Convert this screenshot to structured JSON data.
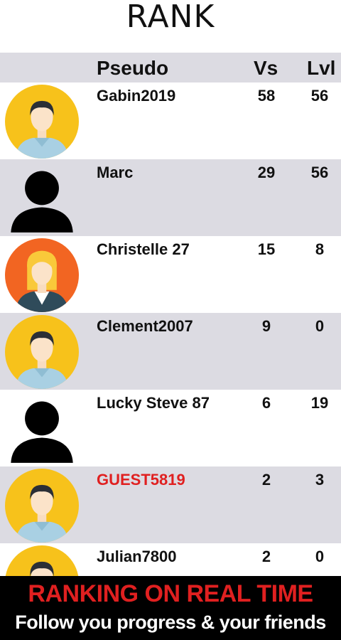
{
  "title": "RANK",
  "columns": {
    "pseudo": "Pseudo",
    "vs": "Vs",
    "lvl": "Lvl"
  },
  "colors": {
    "highlight": "#e02020",
    "row_alt": "#dcdbe2",
    "banner_bg": "#000000"
  },
  "rows": [
    {
      "name": "Gabin2019",
      "vs": "58",
      "lvl": "56",
      "avatar": "man-avatar-icon"
    },
    {
      "name": "Marc",
      "vs": "29",
      "lvl": "56",
      "avatar": "silhouette-avatar-icon"
    },
    {
      "name": "Christelle 27",
      "vs": "15",
      "lvl": "8",
      "avatar": "woman-avatar-icon"
    },
    {
      "name": "Clement2007",
      "vs": "9",
      "lvl": "0",
      "avatar": "man-avatar-icon"
    },
    {
      "name": "Lucky Steve 87",
      "vs": "6",
      "lvl": "19",
      "avatar": "silhouette-avatar-icon"
    },
    {
      "name": "GUEST5819",
      "vs": "2",
      "lvl": "3",
      "avatar": "man-avatar-icon"
    },
    {
      "name": "Julian7800",
      "vs": "2",
      "lvl": "0",
      "avatar": "man-avatar-icon"
    }
  ],
  "banner": {
    "headline": "RANKING ON REAL TIME",
    "subline": "Follow you progress & your friends"
  }
}
